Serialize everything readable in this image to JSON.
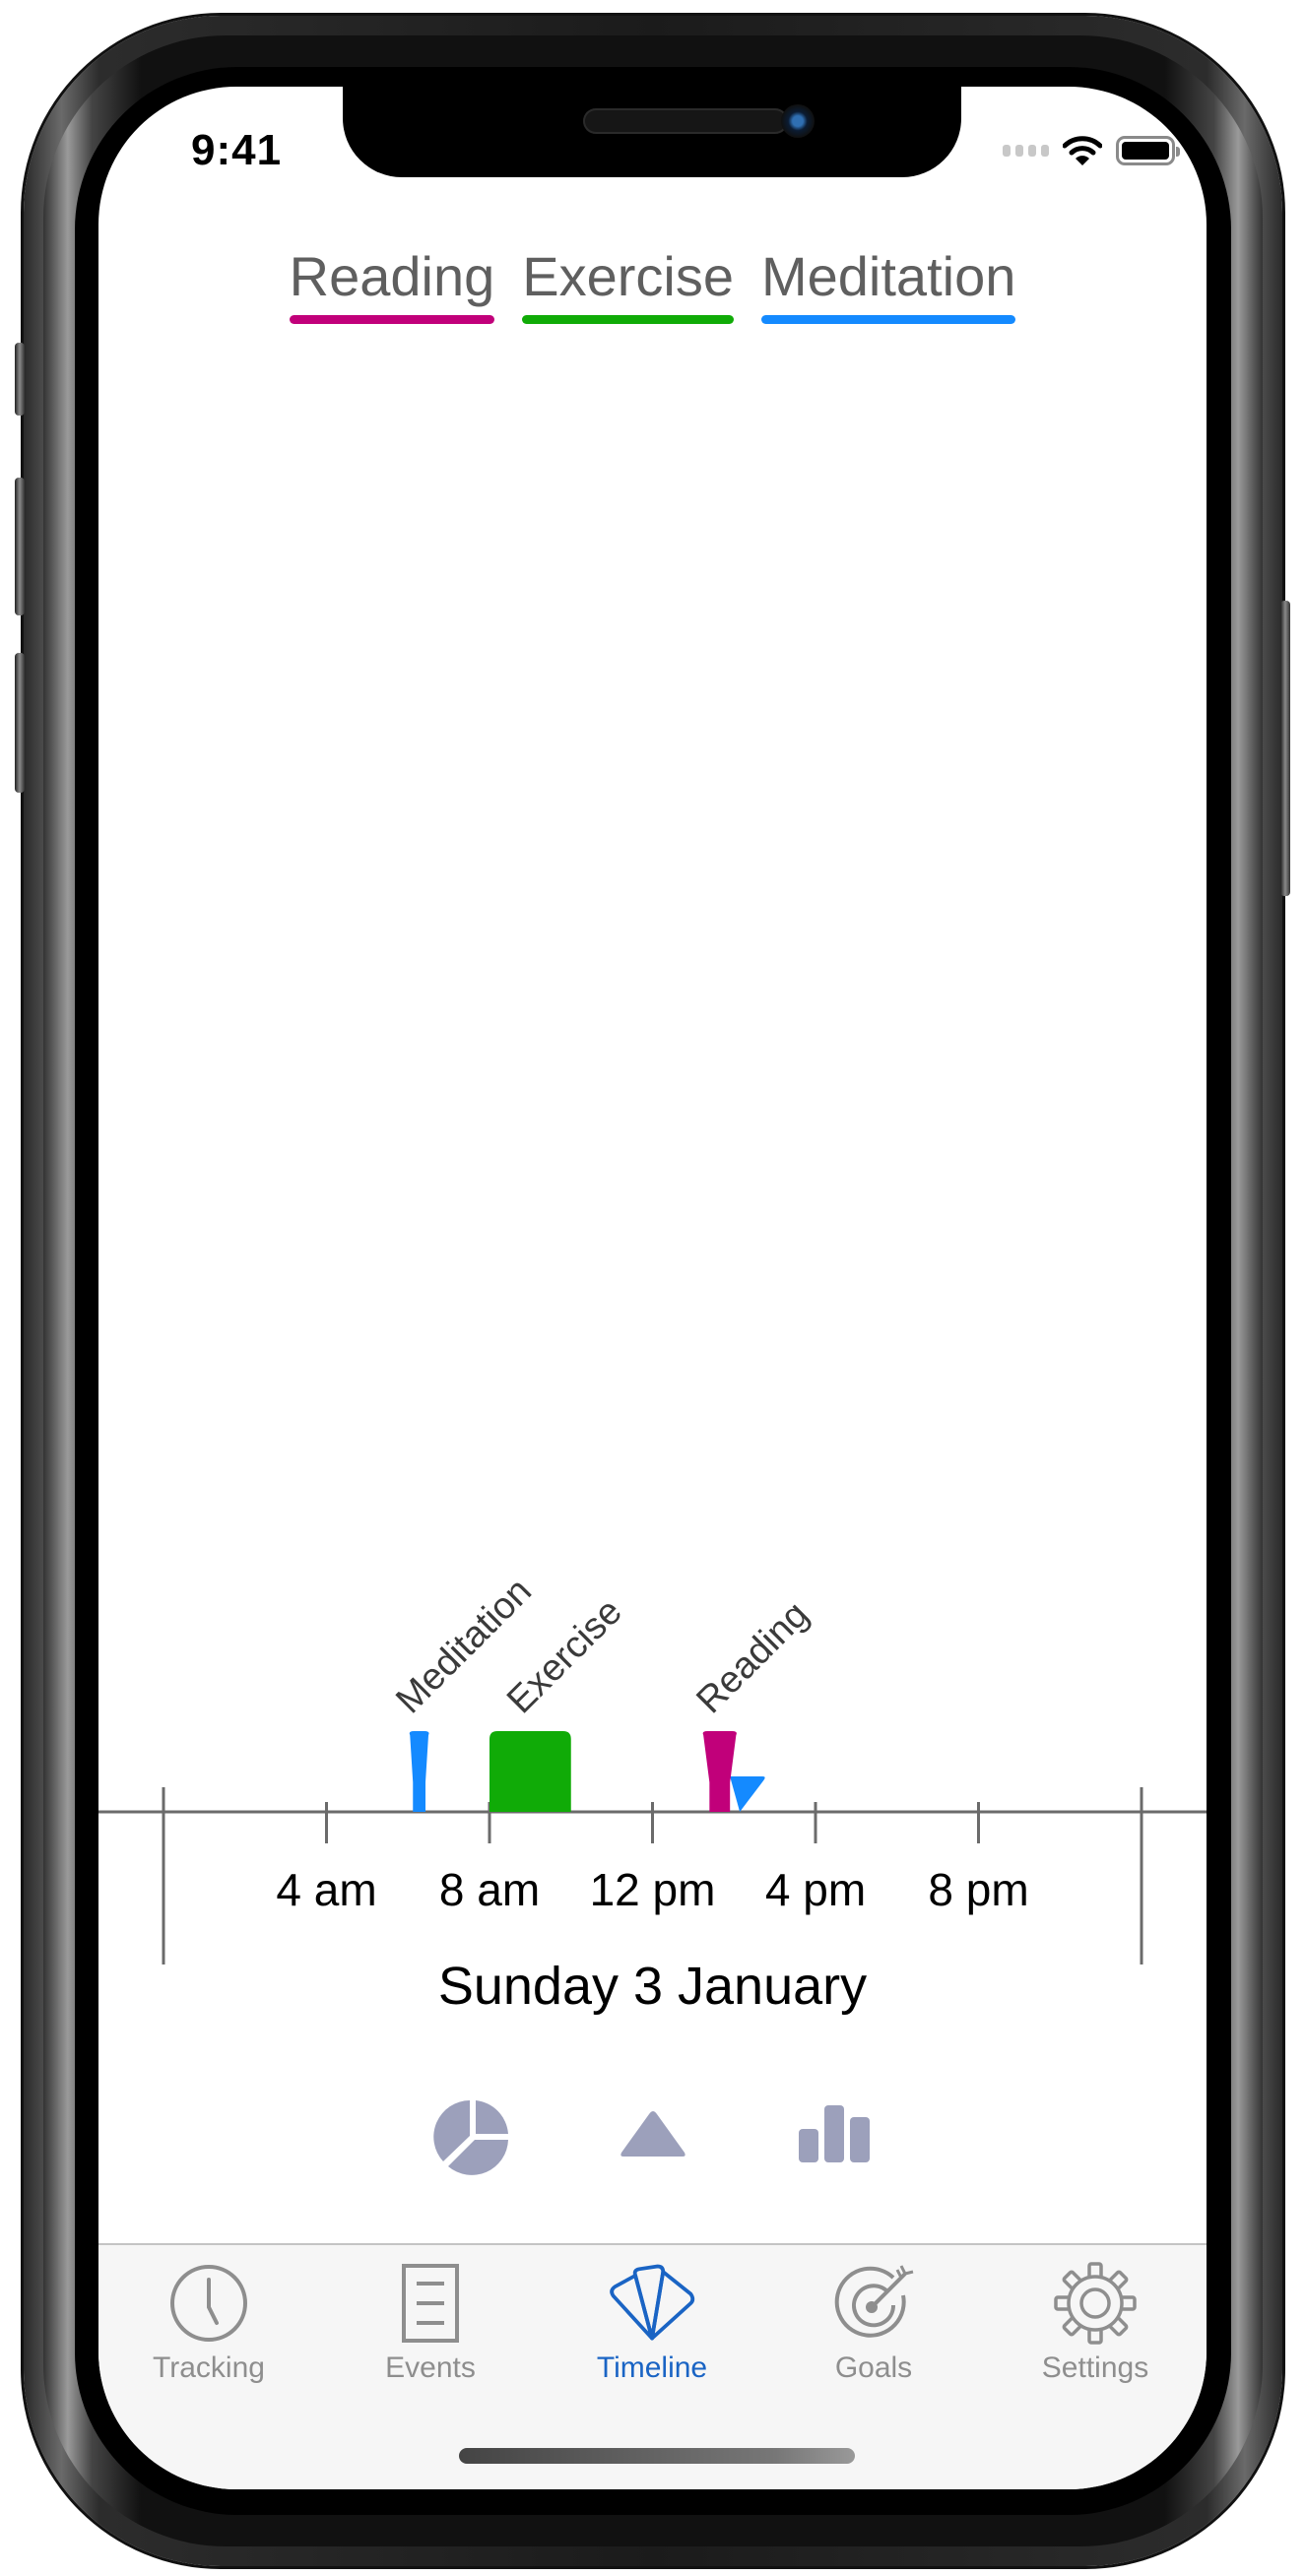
{
  "status_bar": {
    "time": "9:41"
  },
  "legend": [
    {
      "label": "Reading",
      "color": "#c1007a"
    },
    {
      "label": "Exercise",
      "color": "#10ab07"
    },
    {
      "label": "Meditation",
      "color": "#148aff"
    }
  ],
  "chart_data": {
    "type": "timeline",
    "title": "",
    "date_label": "Sunday 3 January",
    "x_unit": "hour of day",
    "x_range": [
      0,
      24
    ],
    "tick_values": [
      4,
      8,
      12,
      16,
      20
    ],
    "tick_labels": [
      "4 am",
      "8 am",
      "12 pm",
      "4 pm",
      "8 pm"
    ],
    "events": [
      {
        "name": "Meditation",
        "category": "Meditation",
        "start": 6.0,
        "end": 6.55,
        "shape": "funnel",
        "show_label": true
      },
      {
        "name": "Exercise",
        "category": "Exercise",
        "start": 8.0,
        "end": 10.0,
        "shape": "block",
        "show_label": true
      },
      {
        "name": "Reading",
        "category": "Reading",
        "start": 13.2,
        "end": 14.1,
        "shape": "funnel",
        "show_label": true
      },
      {
        "name": "Meditation",
        "category": "Meditation",
        "start": 13.9,
        "end": 14.8,
        "shape": "wedge",
        "show_label": false
      }
    ]
  },
  "chart_switcher": [
    {
      "name": "pie-chart",
      "selected": false
    },
    {
      "name": "timeline",
      "selected": true
    },
    {
      "name": "bar-chart",
      "selected": false
    }
  ],
  "switcher_color": "#9ca0bb",
  "tabbar": {
    "active_color": "#1a64c4",
    "inactive_color": "#8e8e8e",
    "tabs": [
      {
        "label": "Tracking",
        "icon": "clock-icon",
        "active": false
      },
      {
        "label": "Events",
        "icon": "list-icon",
        "active": false
      },
      {
        "label": "Timeline",
        "icon": "timeline-icon",
        "active": true
      },
      {
        "label": "Goals",
        "icon": "target-icon",
        "active": false
      },
      {
        "label": "Settings",
        "icon": "gear-icon",
        "active": false
      }
    ]
  }
}
